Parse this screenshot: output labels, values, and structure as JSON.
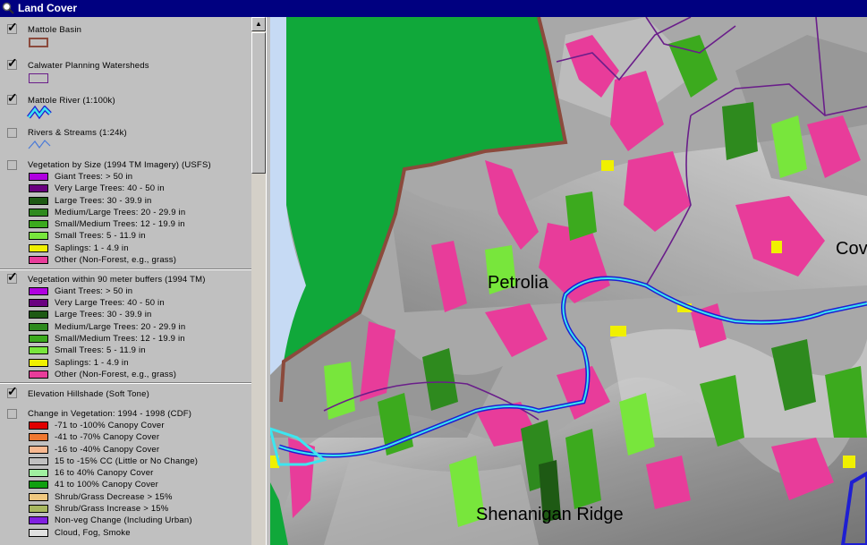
{
  "window": {
    "title": "Land Cover"
  },
  "toc": {
    "layers": [
      {
        "name": "Mattole Basin",
        "checked": true
      },
      {
        "name": "Calwater Planning Watersheds",
        "checked": true
      },
      {
        "name": "Mattole River (1:100k)",
        "checked": true
      },
      {
        "name": "Rivers & Streams (1:24k)",
        "checked": false
      },
      {
        "name": "Vegetation by Size (1994 TM Imagery) (USFS)",
        "checked": false,
        "classes": [
          {
            "label": "Giant Trees: > 50 in",
            "color": "#b000e0"
          },
          {
            "label": "Very Large Trees: 40 - 50 in",
            "color": "#6a0080"
          },
          {
            "label": "Large Trees: 30 - 39.9 in",
            "color": "#1e5a14"
          },
          {
            "label": "Medium/Large Trees: 20 - 29.9 in",
            "color": "#2e8a1e"
          },
          {
            "label": "Small/Medium Trees: 12 - 19.9 in",
            "color": "#3caa1e"
          },
          {
            "label": "Small Trees: 5 - 11.9 in",
            "color": "#78e63c"
          },
          {
            "label": "Saplings: 1 - 4.9 in",
            "color": "#f0f000"
          },
          {
            "label": "Other (Non-Forest, e.g., grass)",
            "color": "#e83c9a"
          }
        ]
      },
      {
        "name": "Vegetation within 90 meter buffers (1994 TM)",
        "checked": true,
        "classes": [
          {
            "label": "Giant Trees: > 50 in",
            "color": "#b000e0"
          },
          {
            "label": "Very Large Trees: 40 - 50 in",
            "color": "#6a0080"
          },
          {
            "label": "Large Trees: 30 - 39.9 in",
            "color": "#1e5a14"
          },
          {
            "label": "Medium/Large Trees: 20 - 29.9 in",
            "color": "#2e8a1e"
          },
          {
            "label": "Small/Medium Trees: 12 - 19.9 in",
            "color": "#3caa1e"
          },
          {
            "label": "Small Trees: 5 - 11.9 in",
            "color": "#78e63c"
          },
          {
            "label": "Saplings: 1 - 4.9 in",
            "color": "#f0f000"
          },
          {
            "label": "Other (Non-Forest, e.g., grass)",
            "color": "#e83c9a"
          }
        ]
      },
      {
        "name": "Elevation Hillshade (Soft Tone)",
        "checked": true
      },
      {
        "name": "Change in Vegetation: 1994 - 1998 (CDF)",
        "checked": false,
        "classes": [
          {
            "label": "-71 to -100% Canopy Cover",
            "color": "#e00000"
          },
          {
            "label": "-41 to -70% Canopy Cover",
            "color": "#f07830"
          },
          {
            "label": "-16 to -40% Canopy Cover",
            "color": "#f8b890"
          },
          {
            "label": "15 to -15% CC (Little or No Change)",
            "color": "#c0c0c0"
          },
          {
            "label": "16 to 40% Canopy Cover",
            "color": "#a0f0a0"
          },
          {
            "label": "41 to 100% Canopy Cover",
            "color": "#10a010"
          },
          {
            "label": "Shrub/Grass Decrease > 15%",
            "color": "#f0c880"
          },
          {
            "label": "Shrub/Grass Increase > 15%",
            "color": "#a8b860"
          },
          {
            "label": "Non-veg Change (Including Urban)",
            "color": "#8020e0"
          },
          {
            "label": "Cloud, Fog, Smoke",
            "color": "#e0e0e0"
          }
        ]
      }
    ]
  },
  "map": {
    "labels": {
      "petrolia": "Petrolia",
      "shenanigan": "Shenanigan Ridge",
      "cov": "Cov"
    },
    "colors": {
      "ocean": "#c6daf4",
      "green": "#10a83a",
      "basin_outline": "#8b4a3c",
      "watershed_outline": "#6a1e8a",
      "river": "#1e1ed2",
      "river_highlight": "#3ce6f0"
    }
  }
}
